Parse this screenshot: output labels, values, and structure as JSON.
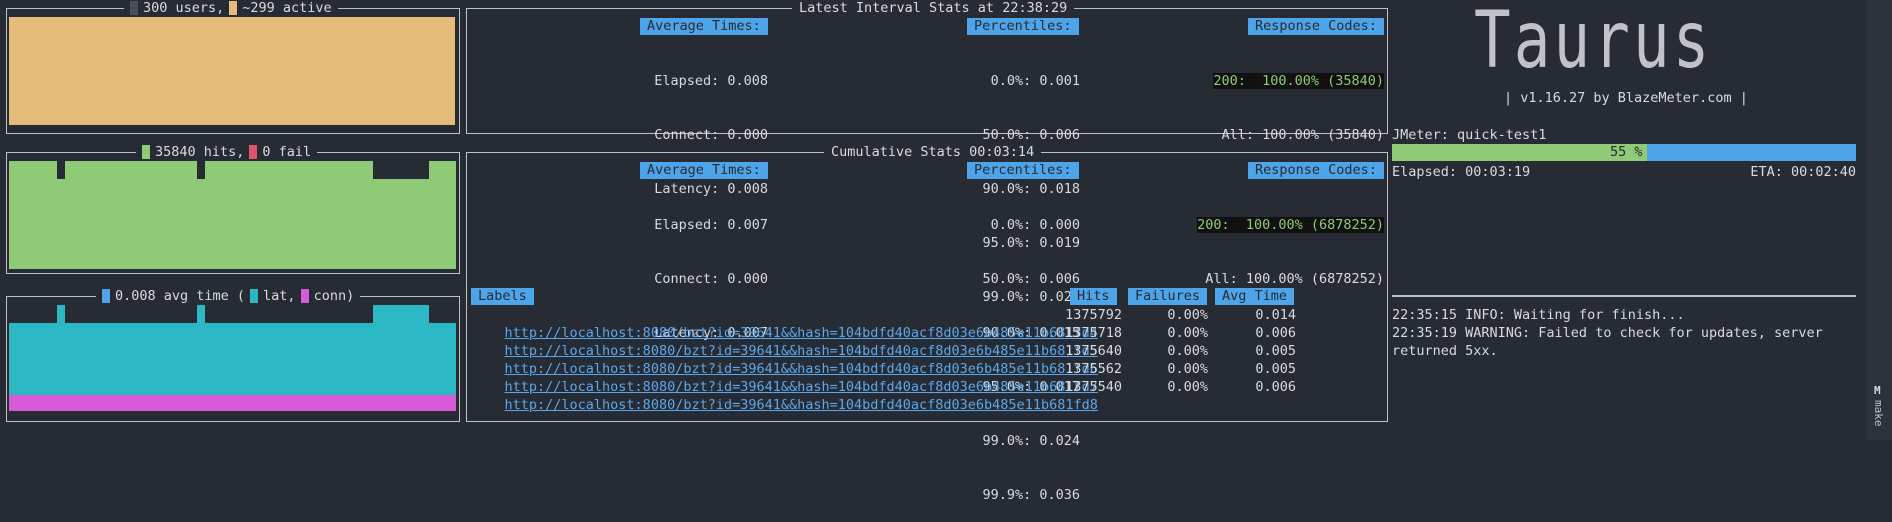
{
  "users_panel": {
    "users": "300 users,",
    "active": "~299 active",
    "colors": {
      "users": "#4b4f57",
      "active": "#e5bd78"
    }
  },
  "hits_panel": {
    "hits": "35840 hits,",
    "fail": "0 fail",
    "colors": {
      "hits": "#8fcb76",
      "fail": "#e0556a"
    }
  },
  "times_panel": {
    "avg": "0.008 avg time (",
    "lat": "lat,",
    "conn": "conn)",
    "colors": {
      "avg": "#4da4e8",
      "lat": "#2bb8c4",
      "conn": "#d75ad7"
    }
  },
  "latest": {
    "title": "Latest Interval Stats at 22:38:29",
    "avg_header": "Average Times:",
    "avg_rows": [
      "Elapsed: 0.008",
      "Connect: 0.000",
      "Latency: 0.008"
    ],
    "pct_header": "Percentiles:",
    "pct_rows": [
      " 0.0%: 0.001",
      "50.0%: 0.006",
      "90.0%: 0.018",
      "95.0%: 0.019",
      "99.0%: 0.024"
    ],
    "rc_header": "Response Codes:",
    "rc_rows": [
      "200:  100.00% (35840)",
      "All: 100.00% (35840)"
    ]
  },
  "cumulative": {
    "title": "Cumulative Stats 00:03:14",
    "avg_header": "Average Times:",
    "avg_rows": [
      "Elapsed: 0.007",
      "Connect: 0.000",
      "Latency: 0.007"
    ],
    "pct_header": "Percentiles:",
    "pct_rows": [
      " 0.0%: 0.000",
      "50.0%: 0.006",
      "90.0%: 0.015",
      "95.0%: 0.017",
      "99.0%: 0.024",
      "99.9%: 0.036"
    ],
    "rc_header": "Response Codes:",
    "rc_rows": [
      "200:  100.00% (6878252)",
      "All: 100.00% (6878252)"
    ]
  },
  "labels_table": {
    "headers": {
      "labels": "Labels",
      "hits": "Hits",
      "failures": "Failures",
      "avg": "Avg Time"
    },
    "rows": [
      {
        "url": "http://localhost:8080/bzt?id=39641&&hash=104bdfd40acf8d03e6b485e11b681fd4",
        "hits": "1375792",
        "fail": "0.00%",
        "avg": "0.014"
      },
      {
        "url": "http://localhost:8080/bzt?id=39641&&hash=104bdfd40acf8d03e6b485e11b681fd5",
        "hits": "1375718",
        "fail": "0.00%",
        "avg": "0.006"
      },
      {
        "url": "http://localhost:8080/bzt?id=39641&&hash=104bdfd40acf8d03e6b485e11b681fd6",
        "hits": "1375640",
        "fail": "0.00%",
        "avg": "0.005"
      },
      {
        "url": "http://localhost:8080/bzt?id=39641&&hash=104bdfd40acf8d03e6b485e11b681fd7",
        "hits": "1375562",
        "fail": "0.00%",
        "avg": "0.005"
      },
      {
        "url": "http://localhost:8080/bzt?id=39641&&hash=104bdfd40acf8d03e6b485e11b681fd8",
        "hits": "1375540",
        "fail": "0.00%",
        "avg": "0.006"
      }
    ]
  },
  "taurus": {
    "logo": "Taurus",
    "version": "| v1.16.27 by BlazeMeter.com |",
    "executor": "JMeter: quick-test1",
    "progress_label": "55 %",
    "progress": 0.55,
    "elapsed": "Elapsed: 00:03:19",
    "eta": "ETA: 00:02:40",
    "colors": {
      "done": "#8fcb76",
      "remaining": "#4da4e8"
    }
  },
  "log": {
    "lines": [
      "22:35:15 INFO: Waiting for finish...",
      "22:35:19 WARNING: Failed to check for updates, server",
      "returned 5xx."
    ]
  },
  "side": {
    "icon": "M",
    "label": "make"
  }
}
